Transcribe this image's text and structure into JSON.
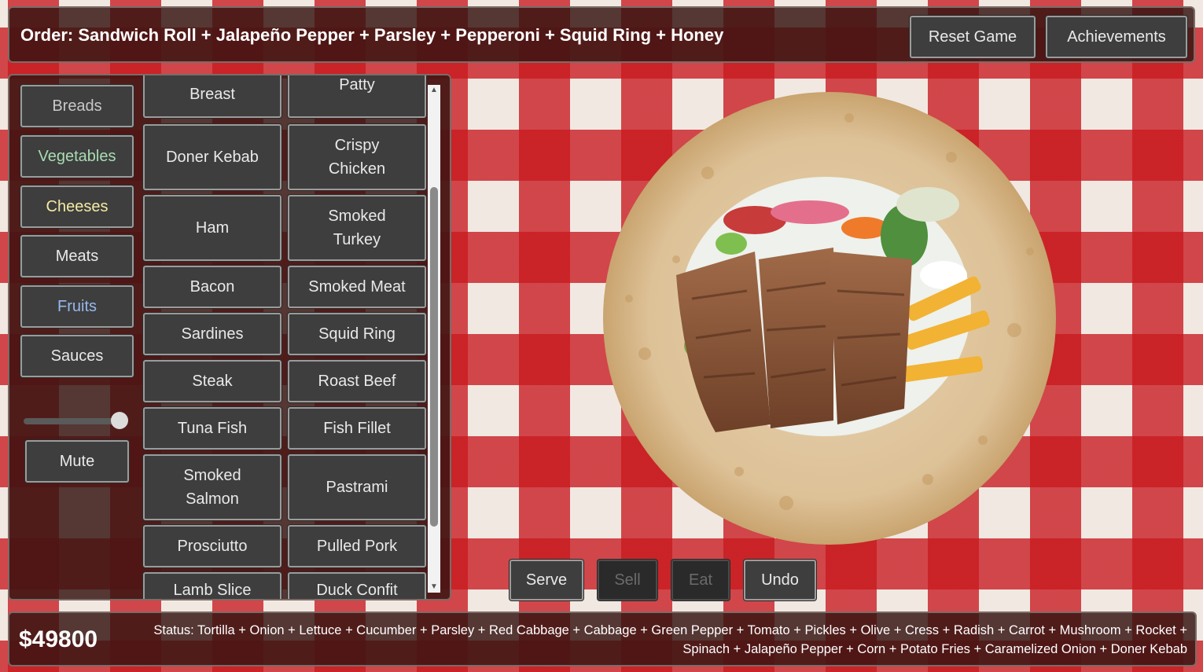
{
  "order": {
    "text": "Order: Sandwich Roll + Jalapeño Pepper + Parsley + Pepperoni + Squid Ring + Honey"
  },
  "header": {
    "reset_label": "Reset Game",
    "achievements_label": "Achievements"
  },
  "categories": [
    {
      "label": "Breads",
      "color": "#c8c8c8"
    },
    {
      "label": "Vegetables",
      "color": "#a9dcb3"
    },
    {
      "label": "Cheeses",
      "color": "#f3eaa4"
    },
    {
      "label": "Meats",
      "color": "#e9e9e9"
    },
    {
      "label": "Fruits",
      "color": "#96b9ef"
    },
    {
      "label": "Sauces",
      "color": "#e9e9e9"
    }
  ],
  "sound": {
    "volume_fraction": 0.95,
    "mute_label": "Mute"
  },
  "items": [
    {
      "left": "Breast",
      "right": "Patty"
    },
    {
      "left": "Doner Kebab",
      "right": "Crispy Chicken"
    },
    {
      "left": "Ham",
      "right": "Smoked Turkey"
    },
    {
      "left": "Bacon",
      "right": "Smoked Meat"
    },
    {
      "left": "Sardines",
      "right": "Squid Ring"
    },
    {
      "left": "Steak",
      "right": "Roast Beef"
    },
    {
      "left": "Tuna Fish",
      "right": "Fish Fillet"
    },
    {
      "left": "Smoked Salmon",
      "right": "Pastrami"
    },
    {
      "left": "Prosciutto",
      "right": "Pulled Pork"
    },
    {
      "left": "Lamb Slice",
      "right": "Duck Confit"
    }
  ],
  "actions": {
    "serve": "Serve",
    "sell": "Sell",
    "eat": "Eat",
    "undo": "Undo"
  },
  "footer": {
    "money": "$49800",
    "status": "Status: Tortilla + Onion + Lettuce + Cucumber + Parsley + Red Cabbage + Cabbage + Green Pepper + Tomato + Pickles + Olive + Cress + Radish + Carrot + Mushroom + Rocket + Spinach + Jalapeño Pepper + Corn + Potato Fries + Caramelized Onion + Doner Kebab"
  },
  "colors": {
    "tablecloth_red": "#c8191e",
    "panel": "#37140f",
    "button": "#3e3e3e",
    "disabled_button": "#2a2a2a"
  }
}
